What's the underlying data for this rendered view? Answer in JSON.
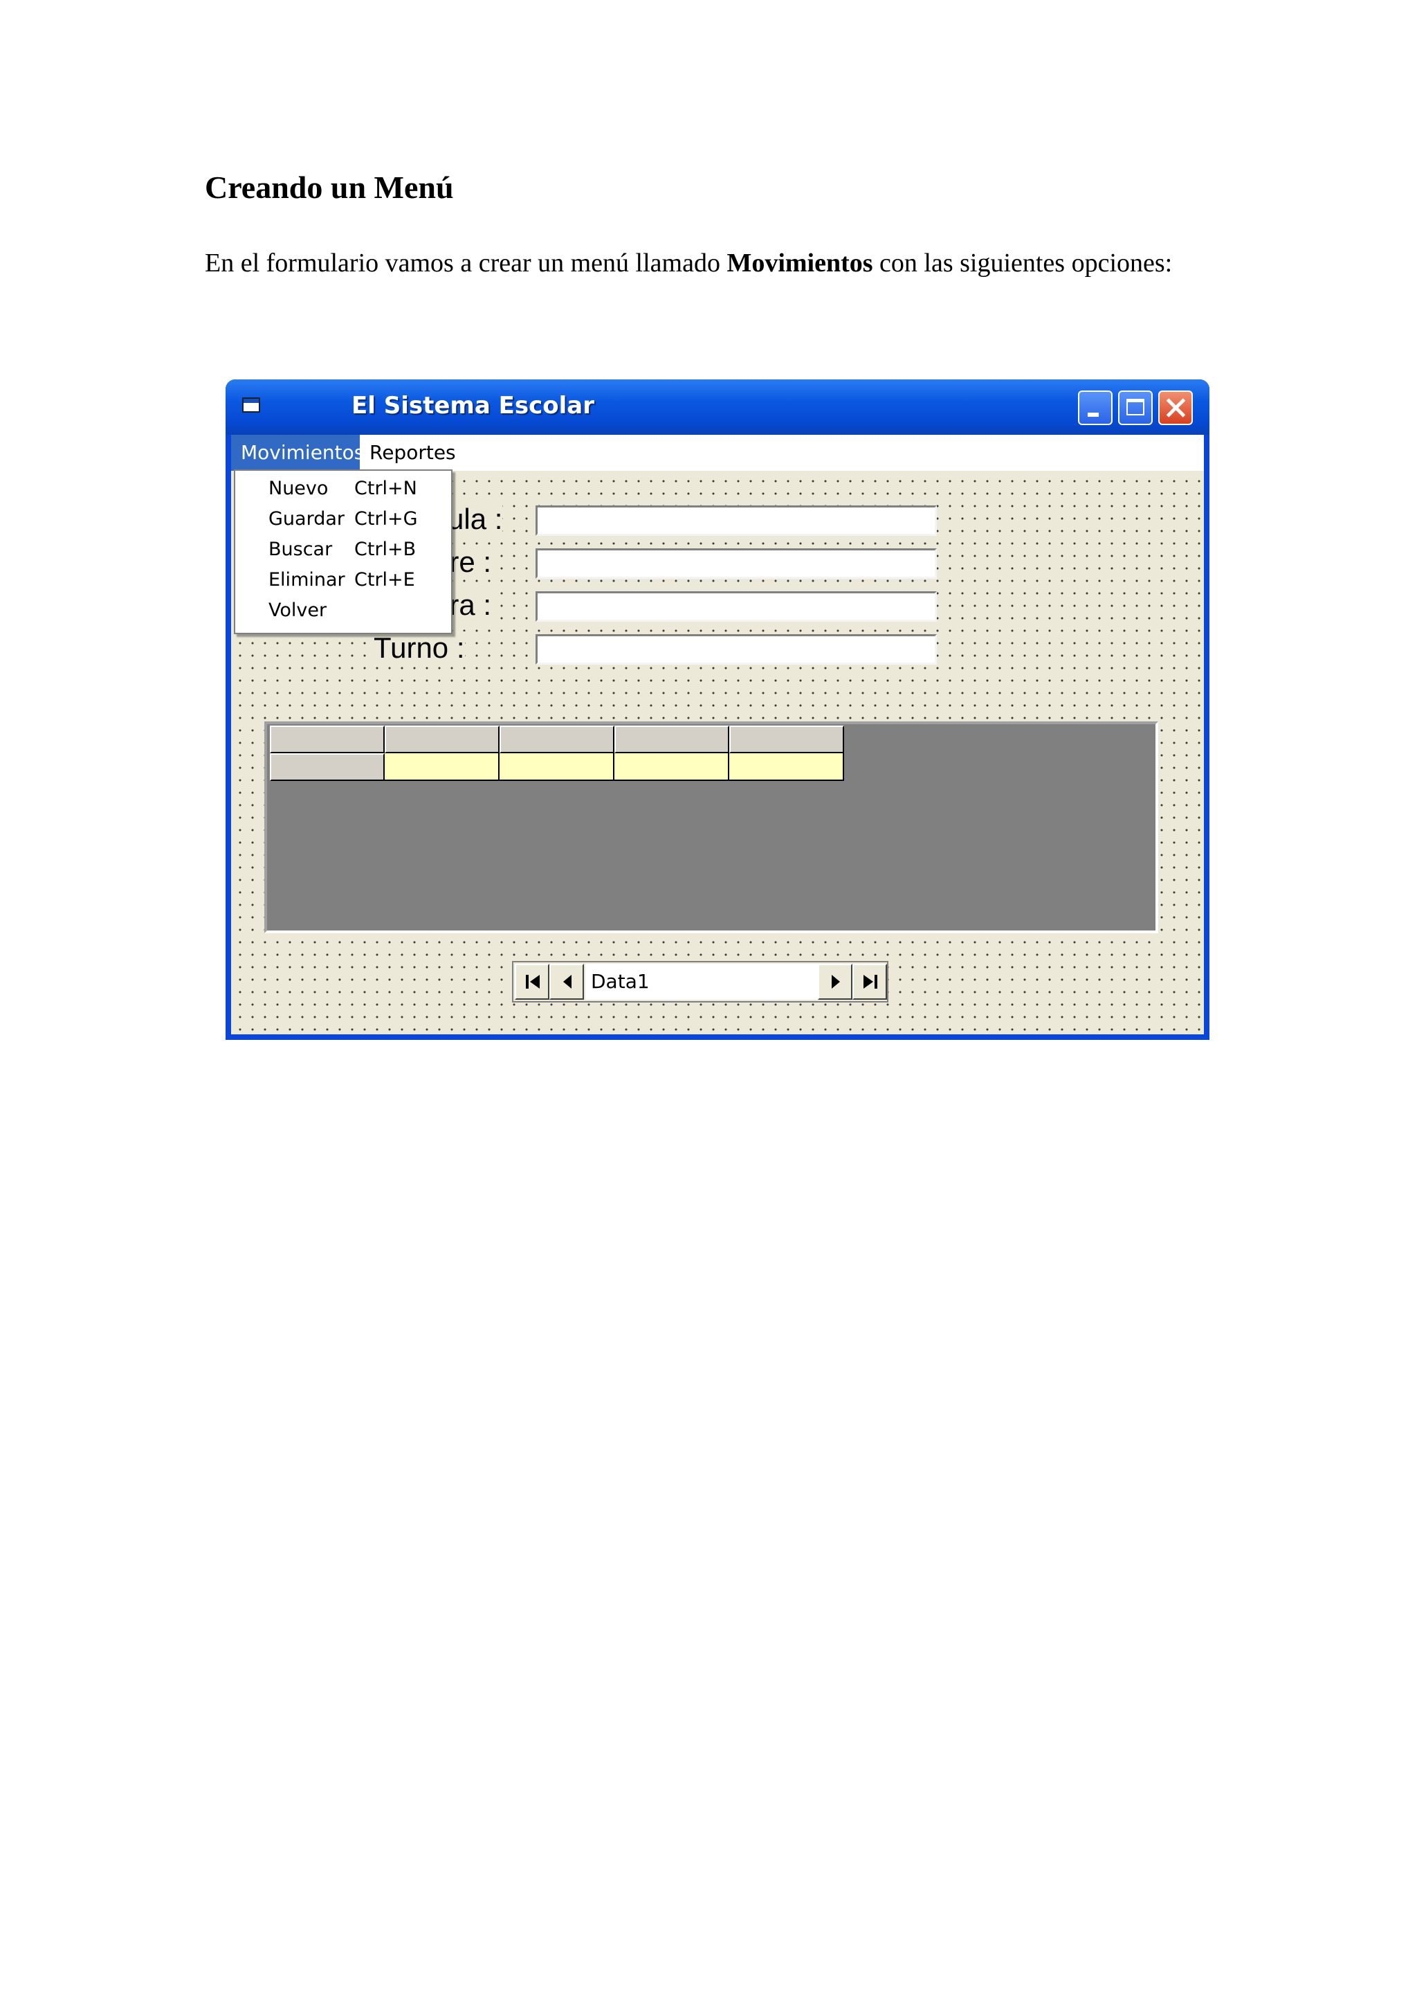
{
  "document": {
    "heading": "Creando un Menú",
    "intro_before": "En el formulario vamos a crear un menú llamado ",
    "intro_bold": "Movimientos",
    "intro_after": " con las siguientes opciones:"
  },
  "window": {
    "title": "El Sistema Escolar",
    "title_icon": "form-window-icon",
    "controls": [
      "minimize-icon",
      "maximize-icon",
      "close-icon"
    ]
  },
  "menubar": {
    "items": [
      {
        "label": "Movimientos",
        "active": true
      },
      {
        "label": "Reportes",
        "active": false
      }
    ]
  },
  "dropdown": {
    "items": [
      {
        "label": "Nuevo",
        "shortcut": "Ctrl+N"
      },
      {
        "label": "Guardar",
        "shortcut": "Ctrl+G"
      },
      {
        "label": "Buscar",
        "shortcut": "Ctrl+B"
      },
      {
        "label": "Eliminar",
        "shortcut": "Ctrl+E"
      },
      {
        "label": "Volver",
        "shortcut": ""
      }
    ]
  },
  "form": {
    "labels": [
      {
        "visible_text": "cula :"
      },
      {
        "visible_text": "bre :"
      },
      {
        "visible_text": "era :"
      },
      {
        "visible_text": "Turno :"
      }
    ]
  },
  "grid": {
    "columns": 5,
    "rows": 1
  },
  "data_control": {
    "caption": "Data1",
    "buttons": [
      "first-record-icon",
      "previous-record-icon",
      "next-record-icon",
      "last-record-icon"
    ]
  },
  "colors": {
    "titlebar": "#0b58e0",
    "menu_highlight": "#316ac5",
    "form_background": "#ece9d8",
    "grid_background": "#808080",
    "grid_data_cell": "#ffffc0"
  }
}
